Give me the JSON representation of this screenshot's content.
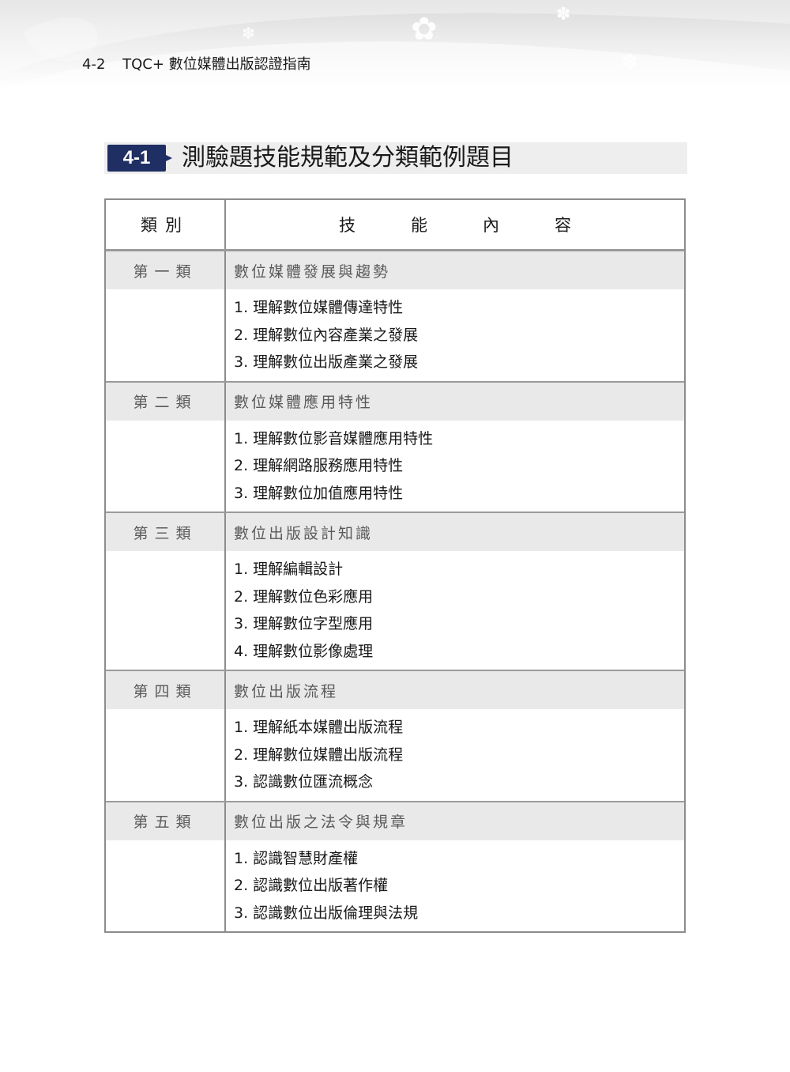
{
  "running_head": {
    "page_number": "4-2",
    "book_title": "TQC+ 數位媒體出版認證指南"
  },
  "section": {
    "badge": "4-1",
    "heading": "測驗題技能規範及分類範例題目"
  },
  "table": {
    "header": {
      "category": "類別",
      "skill": "技能內容"
    },
    "categories": [
      {
        "label": "第一類",
        "title": "數位媒體發展與趨勢",
        "items": [
          "1. 理解數位媒體傳達特性",
          "2. 理解數位內容產業之發展",
          "3. 理解數位出版產業之發展"
        ]
      },
      {
        "label": "第二類",
        "title": "數位媒體應用特性",
        "items": [
          "1. 理解數位影音媒體應用特性",
          "2. 理解網路服務應用特性",
          "3. 理解數位加值應用特性"
        ]
      },
      {
        "label": "第三類",
        "title": "數位出版設計知識",
        "items": [
          "1. 理解編輯設計",
          "2. 理解數位色彩應用",
          "3. 理解數位字型應用",
          "4. 理解數位影像處理"
        ]
      },
      {
        "label": "第四類",
        "title": "數位出版流程",
        "items": [
          "1. 理解紙本媒體出版流程",
          "2. 理解數位媒體出版流程",
          "3. 認識數位匯流概念"
        ]
      },
      {
        "label": "第五類",
        "title": "數位出版之法令與規章",
        "items": [
          "1. 認識智慧財產權",
          "2. 認識數位出版著作權",
          "3. 認識數位出版倫理與法規"
        ]
      }
    ]
  },
  "colors": {
    "badge_background": "#1f2f63",
    "category_row_background": "#e9e9e9",
    "section_bar_background": "#eeeeee",
    "table_border": "#8c8c8c"
  },
  "icons": {
    "banner_decoration": "flower-icon"
  }
}
